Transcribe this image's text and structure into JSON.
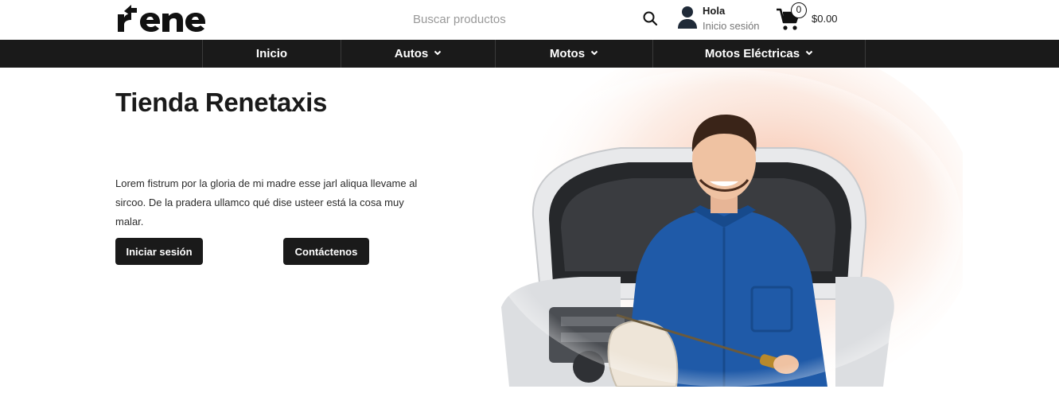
{
  "header": {
    "logo_text": "rene",
    "search": {
      "placeholder": "Buscar productos",
      "value": ""
    },
    "user": {
      "greeting": "Hola",
      "login_label": "Inicio sesión"
    },
    "cart": {
      "count": "0",
      "total": "$0.00"
    }
  },
  "nav": {
    "items": [
      {
        "label": "Inicio",
        "has_dropdown": false
      },
      {
        "label": "Autos",
        "has_dropdown": true
      },
      {
        "label": "Motos",
        "has_dropdown": true
      },
      {
        "label": "Motos Eléctricas",
        "has_dropdown": true
      }
    ]
  },
  "hero": {
    "title": "Tienda Renetaxis",
    "text": "Lorem fistrum por la gloria de mi madre esse jarl aliqua llevame al sircoo. De la pradera ullamco qué dise usteer está la cosa muy malar.",
    "login_button": "Iniciar sesión",
    "contact_button": "Contáctenos"
  },
  "colors": {
    "dark": "#1a1a1a",
    "mechanic_uniform": "#1f5aa8",
    "car_white": "#e8e9eb"
  }
}
